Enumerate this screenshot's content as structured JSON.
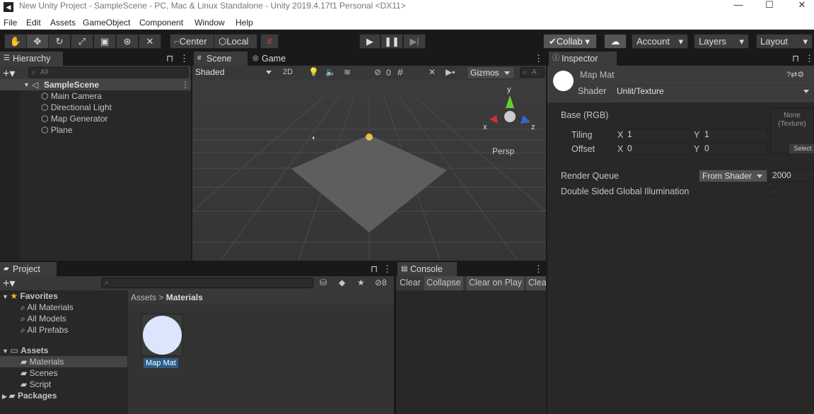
{
  "window": {
    "title": "New Unity Project - SampleScene - PC, Mac & Linux Standalone - Unity 2019.4.17f1 Personal <DX11>",
    "minimize": "—",
    "maximize": "☐",
    "close": "✕"
  },
  "menu": [
    "File",
    "Edit",
    "Assets",
    "GameObject",
    "Component",
    "Window",
    "Help"
  ],
  "toolbar": {
    "pivot": "Center",
    "space": "Local",
    "collab": "Collab",
    "account": "Account",
    "layers": "Layers",
    "layout": "Layout"
  },
  "hierarchy": {
    "tab": "Hierarchy",
    "search_placeholder": "All",
    "scene": "SampleScene",
    "items": [
      "Main Camera",
      "Directional Light",
      "Map Generator",
      "Plane"
    ]
  },
  "scene": {
    "tab_scene": "Scene",
    "tab_game": "Game",
    "shading": "Shaded",
    "mode2d": "2D",
    "hidden_count": "0",
    "gizmos": "Gizmos",
    "persp": "Persp",
    "axes": {
      "x": "x",
      "y": "y",
      "z": "z"
    }
  },
  "inspector": {
    "tab": "Inspector",
    "name": "Map Mat",
    "shader_label": "Shader",
    "shader": "Unlit/Texture",
    "base": "Base (RGB)",
    "tiling": "Tiling",
    "offset": "Offset",
    "tx": "1",
    "ty": "1",
    "ox": "0",
    "oy": "0",
    "x": "X",
    "y": "Y",
    "tex_none": "None",
    "tex_type": "(Texture)",
    "select": "Select",
    "rq_label": "Render Queue",
    "rq_mode": "From Shader",
    "rq_value": "2000",
    "dsgi": "Double Sided Global Illumination"
  },
  "project": {
    "tab": "Project",
    "favorites": "Favorites",
    "fav_items": [
      "All Materials",
      "All Models",
      "All Prefabs"
    ],
    "assets": "Assets",
    "asset_items": [
      "Materials",
      "Scenes",
      "Script"
    ],
    "packages": "Packages",
    "crumb_root": "Assets",
    "crumb_sep": ">",
    "crumb_leaf": "Materials",
    "asset_name": "Map Mat",
    "hidden_count": "8"
  },
  "console": {
    "tab": "Console",
    "buttons": [
      "Clear",
      "Collapse",
      "Clear on Play",
      "Clea"
    ]
  }
}
